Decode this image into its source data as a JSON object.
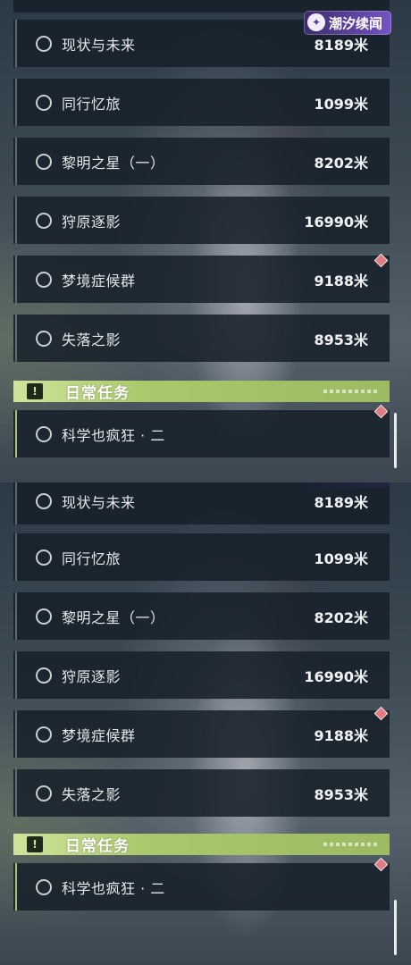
{
  "watermark": {
    "text": "潮汐续闻"
  },
  "quests": [
    {
      "name": "现状与未来",
      "distance": "8189米"
    },
    {
      "name": "同行忆旅",
      "distance": "1099米"
    },
    {
      "name": "黎明之星（一）",
      "distance": "8202米"
    },
    {
      "name": "狩原逐影",
      "distance": "16990米"
    },
    {
      "name": "梦境症候群",
      "distance": "9188米"
    },
    {
      "name": "失落之影",
      "distance": "8953米"
    }
  ],
  "daily_section": {
    "badge": "!",
    "title": "日常任务",
    "items": [
      {
        "name": "科学也疯狂 · 二"
      }
    ]
  },
  "colors": {
    "card_bg": "#16202a",
    "daily_accent": "#a9c96c",
    "marker": "#e07a84",
    "watermark": "#7653c4"
  },
  "icons": {
    "radio": "radio-circle-icon",
    "marker": "diamond-marker-icon",
    "daily_badge": "exclamation-badge-icon"
  }
}
